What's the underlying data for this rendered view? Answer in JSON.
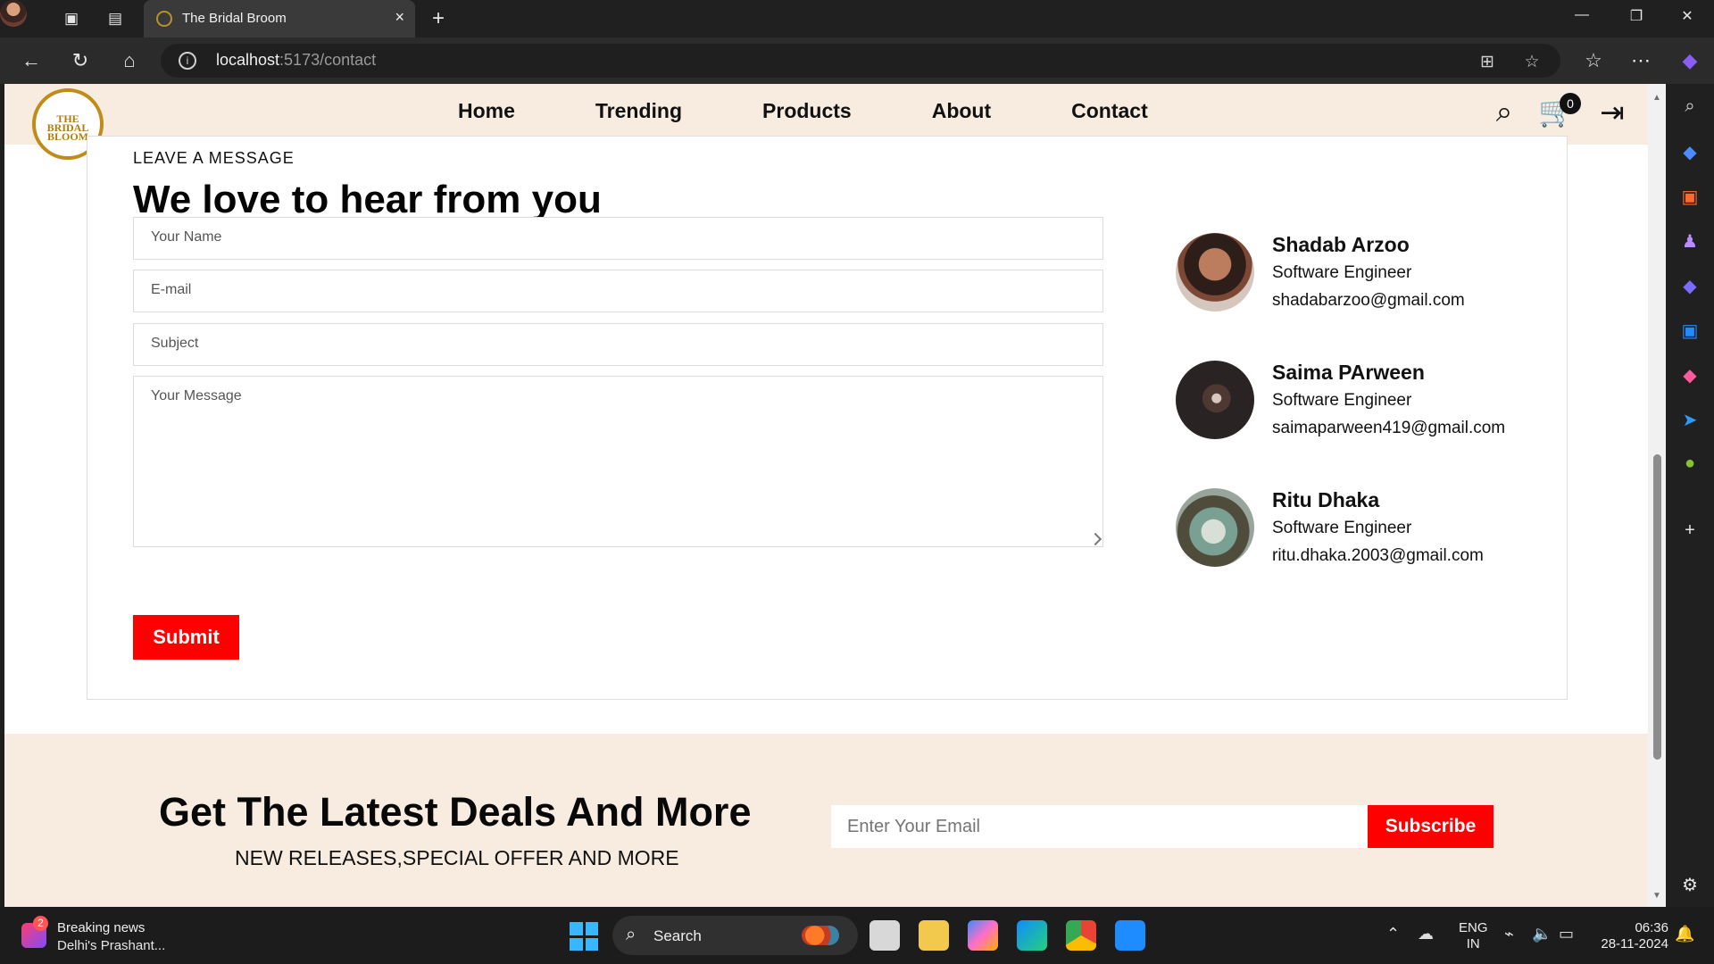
{
  "browser": {
    "tab_title": "The Bridal Broom",
    "url_host": "localhost",
    "url_path": ":5173/contact",
    "icons": [
      "profile-icon",
      "collections-icon",
      "tab-actions-icon",
      "close-tab-icon",
      "new-tab-icon",
      "back-icon",
      "refresh-icon",
      "home-icon",
      "site-info-icon",
      "apps-icon",
      "favorite-icon",
      "favorites-icon",
      "more-icon",
      "copilot-icon"
    ]
  },
  "site": {
    "logo_line1": "THE",
    "logo_line2": "BRIDAL",
    "logo_line3": "BLOOM",
    "nav": [
      "Home",
      "Trending",
      "Products",
      "About",
      "Contact"
    ],
    "cart_count": "0"
  },
  "contact": {
    "eyebrow": "LEAVE A MESSAGE",
    "heading": "We love to hear from you",
    "name_placeholder": "Your Name",
    "email_placeholder": "E-mail",
    "subject_placeholder": "Subject",
    "message_placeholder": "Your Message",
    "submit": "Submit",
    "people": [
      {
        "name": "Shadab Arzoo",
        "role": "Software Engineer",
        "email": "shadabarzoo@gmail.com"
      },
      {
        "name": "Saima PArween",
        "role": "Software Engineer",
        "email": "saimaparween419@gmail.com"
      },
      {
        "name": "Ritu Dhaka",
        "role": "Software Engineer",
        "email": "ritu.dhaka.2003@gmail.com"
      }
    ]
  },
  "deals": {
    "title": "Get The Latest Deals And More",
    "subtitle": "NEW RELEASES,SPECIAL OFFER AND MORE",
    "email_placeholder": "Enter Your Email",
    "subscribe": "Subscribe"
  },
  "taskbar": {
    "news_count": "2",
    "news_title": "Breaking news",
    "news_subtitle": "Delhi's Prashant...",
    "search": "Search",
    "language": "ENG",
    "region": "IN",
    "time": "06:36",
    "date": "28-11-2024"
  }
}
